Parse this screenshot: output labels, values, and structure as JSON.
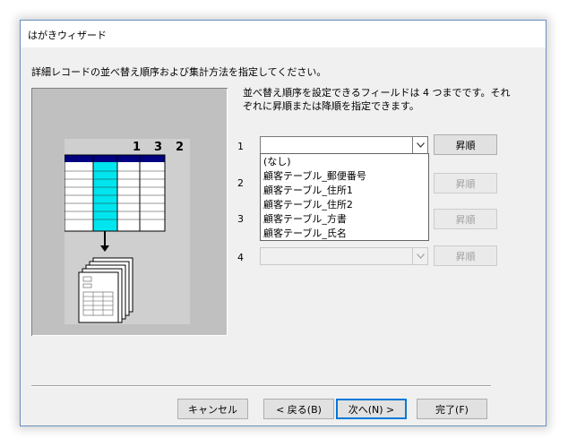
{
  "window": {
    "title": "はがきウィザード",
    "instruction": "詳細レコードの並べ替え順序および集計方法を指定してください。",
    "hint": "並べ替え順序を設定できるフィールドは 4 つまでです。それぞれに昇順または降順を指定できます。"
  },
  "preview": {
    "sort_numbers": [
      "1",
      "3",
      "2"
    ]
  },
  "sort_rows": [
    {
      "number": "1",
      "value": "",
      "order_label": "昇順"
    },
    {
      "number": "2",
      "value": "",
      "order_label": "昇順"
    },
    {
      "number": "3",
      "value": "",
      "order_label": "昇順"
    },
    {
      "number": "4",
      "value": "",
      "order_label": "昇順"
    }
  ],
  "dropdown": {
    "options": [
      "(なし)",
      "顧客テーブル_郵便番号",
      "顧客テーブル_住所1",
      "顧客テーブル_住所2",
      "顧客テーブル_方書",
      "顧客テーブル_氏名"
    ]
  },
  "buttons": {
    "cancel": "キャンセル",
    "back": "< 戻る(B)",
    "next": "次へ(N) >",
    "finish": "完了(F)"
  },
  "colors": {
    "accent": "#0078d7",
    "table_header": "#000080",
    "highlight_column": "#00e5ee",
    "preview_bg": "#c0c0c0"
  }
}
